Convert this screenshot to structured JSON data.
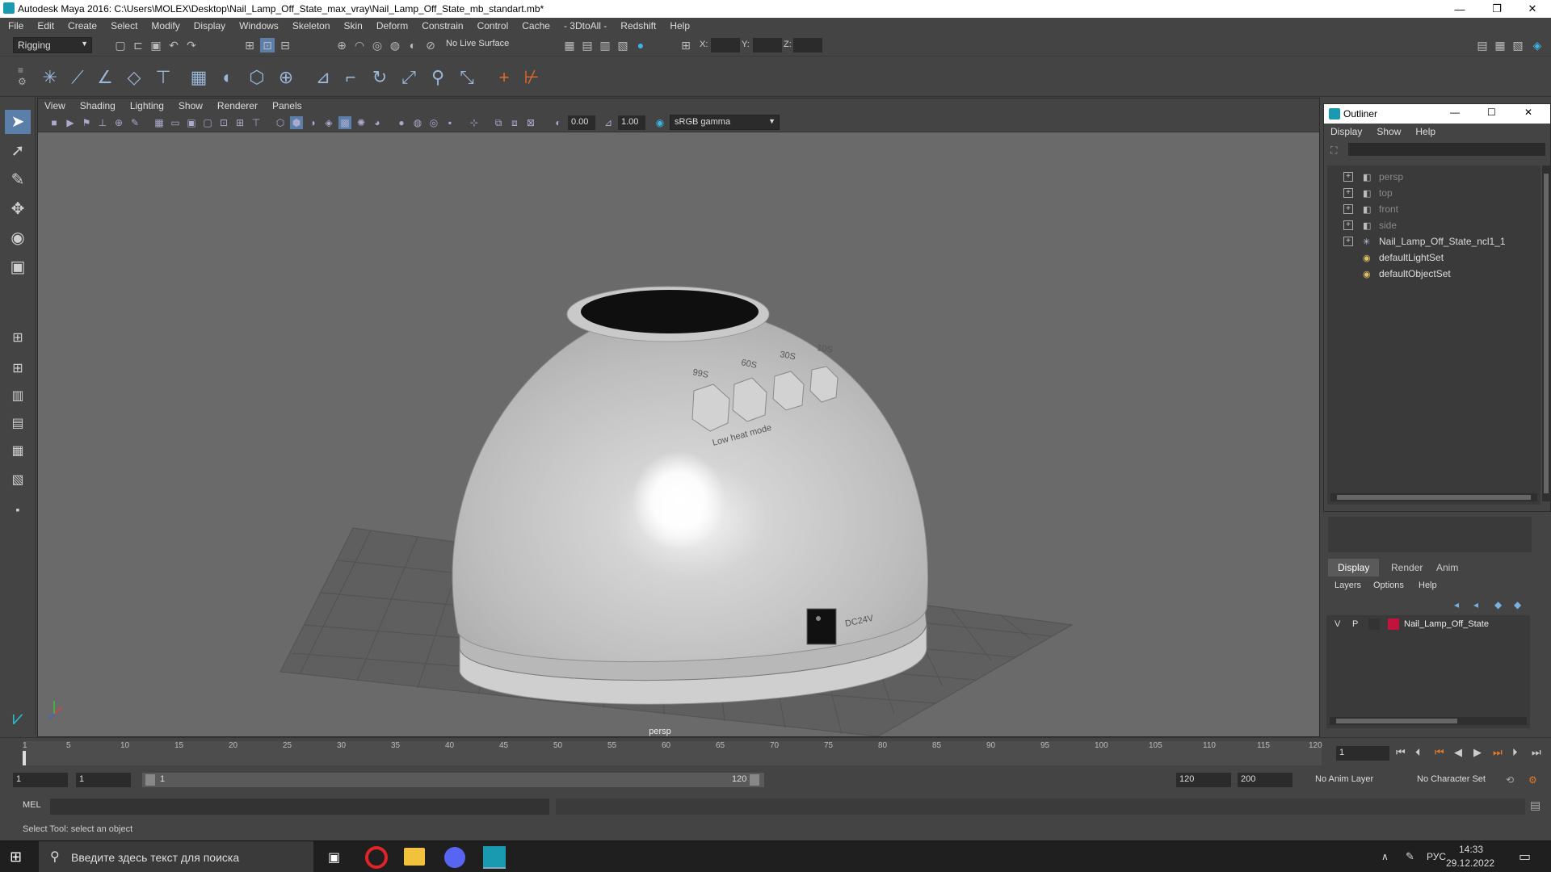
{
  "window": {
    "title": "Autodesk Maya 2016: C:\\Users\\MOLEX\\Desktop\\Nail_Lamp_Off_State_max_vray\\Nail_Lamp_Off_State_mb_standart.mb*"
  },
  "menus": [
    "File",
    "Edit",
    "Create",
    "Select",
    "Modify",
    "Display",
    "Windows",
    "Skeleton",
    "Skin",
    "Deform",
    "Constrain",
    "Control",
    "Cache",
    "- 3DtoAll -",
    "Redshift",
    "Help"
  ],
  "statusline": {
    "mode": "Rigging",
    "live_surface": "No Live Surface",
    "x_label": "X:",
    "y_label": "Y:",
    "z_label": "Z:"
  },
  "viewport": {
    "menus": [
      "View",
      "Shading",
      "Lighting",
      "Show",
      "Renderer",
      "Panels"
    ],
    "near_value": "0.00",
    "far_value": "1.00",
    "color_space": "sRGB gamma",
    "camera_label": "persp",
    "model_texts": {
      "b1": "99S",
      "b2": "60S",
      "b3": "30S",
      "b4": "10S",
      "low_heat": "Low heat mode",
      "dc": "DC24V"
    }
  },
  "outliner": {
    "title": "Outliner",
    "menus": [
      "Display",
      "Show",
      "Help"
    ],
    "items": [
      {
        "label": "persp",
        "type": "camera",
        "dim": true
      },
      {
        "label": "top",
        "type": "camera",
        "dim": true
      },
      {
        "label": "front",
        "type": "camera",
        "dim": true
      },
      {
        "label": "side",
        "type": "camera",
        "dim": true
      },
      {
        "label": "Nail_Lamp_Off_State_ncl1_1",
        "type": "group",
        "dim": false
      },
      {
        "label": "defaultLightSet",
        "type": "set",
        "dim": false
      },
      {
        "label": "defaultObjectSet",
        "type": "set",
        "dim": false
      }
    ]
  },
  "layers": {
    "tabs": [
      "Display",
      "Render",
      "Anim"
    ],
    "menus": [
      "Layers",
      "Options",
      "Help"
    ],
    "rows": [
      {
        "v": "V",
        "p": "P",
        "name": "Nail_Lamp_Off_State",
        "color": "#c0143c"
      }
    ]
  },
  "timeline": {
    "ticks": [
      "1",
      "5",
      "10",
      "15",
      "20",
      "25",
      "30",
      "35",
      "40",
      "45",
      "50",
      "55",
      "60",
      "65",
      "70",
      "75",
      "80",
      "85",
      "90",
      "95",
      "100",
      "105",
      "110",
      "115",
      "120"
    ],
    "current_frame": "1"
  },
  "range": {
    "start": "1",
    "start2": "1",
    "slider_start": "1",
    "slider_end": "120",
    "end": "120",
    "end2": "200",
    "anim_layer": "No Anim Layer",
    "char_set": "No Character Set"
  },
  "cmd": {
    "label": "MEL"
  },
  "help": {
    "text": "Select Tool: select an object"
  },
  "taskbar": {
    "search_placeholder": "Введите здесь текст для поиска",
    "lang": "РУС",
    "time": "14:33",
    "date": "29.12.2022"
  }
}
